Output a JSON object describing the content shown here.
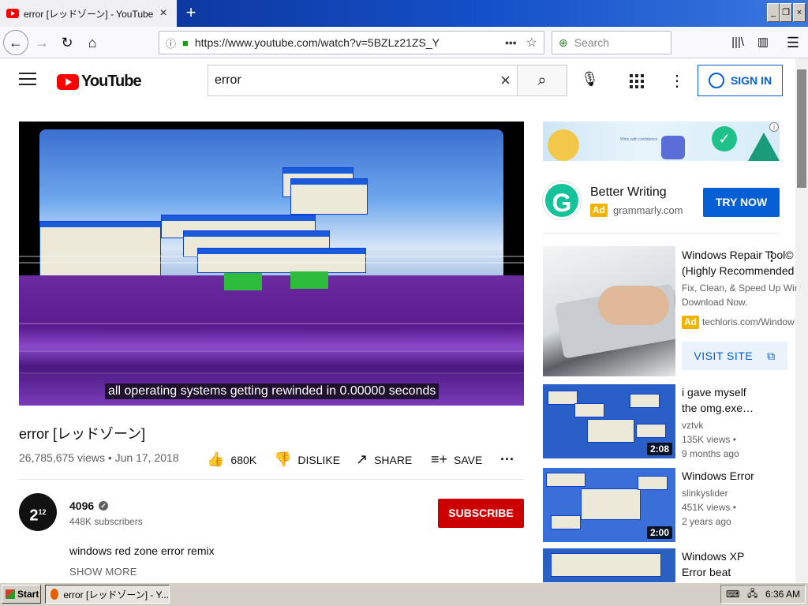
{
  "browser": {
    "tab_title": "error [レッドゾーン] - YouTube",
    "tab_close": "×",
    "new_tab": "+",
    "url": "https://www.youtube.com/watch?v=5BZLz21ZS_Y",
    "search_placeholder": "Search",
    "window_controls": [
      "_",
      "❐",
      "×"
    ]
  },
  "youtube_header": {
    "logo_text": "YouTube",
    "search_query": "error",
    "sign_in_label": "SIGN IN"
  },
  "player": {
    "caption": "all operating systems getting rewinded in 0.00000 seconds"
  },
  "video": {
    "title": "error [レッドゾーン]",
    "meta": "26,785,675 views • Jun 17, 2018",
    "actions": {
      "likes": "680K",
      "dislike": "DISLIKE",
      "share": "SHARE",
      "save": "SAVE"
    },
    "channel": {
      "avatar_text": "2",
      "name": "4096",
      "subscribers": "448K subscribers"
    },
    "subscribe_label": "SUBSCRIBE",
    "description": "windows red zone error remix",
    "show_more": "SHOW MORE"
  },
  "sidebar": {
    "ad": {
      "title": "Better Writing",
      "badge": "Ad",
      "domain": "grammarly.com",
      "cta": "TRY NOW",
      "logo_letter": "G",
      "banner_tagline": "Write with confidence"
    },
    "sponsored": {
      "title_line1": "Windows Repair Tool©",
      "title_line2": "(Highly Recommended",
      "desc_line1": "Fix, Clean, & Speed Up Win",
      "desc_line2": "Download Now.",
      "badge": "Ad",
      "domain": "techloris.com/Window",
      "cta": "VISIT SITE"
    },
    "related": [
      {
        "title_line1": "i gave myself",
        "title_line2": "the omg.exe…",
        "channel": "vztvk",
        "views": "135K views •",
        "ago": "9 months ago",
        "duration": "2:08"
      },
      {
        "title_line1": "Windows Error",
        "title_line2": "",
        "channel": "slinkyslider",
        "views": "451K views •",
        "ago": "2 years ago",
        "duration": "2:00"
      },
      {
        "title_line1": "Windows XP",
        "title_line2": "Error beat",
        "channel": "",
        "views": "",
        "ago": "",
        "duration": ""
      }
    ]
  },
  "taskbar": {
    "start_label": "Start",
    "task_label": "error [レッドゾーン] - Y...",
    "clock": "6:36 AM"
  },
  "colors": {
    "youtube_red": "#ff0000",
    "subscribe_red": "#cc0000",
    "link_blue": "#065fd4",
    "ad_yellow": "#f0b400"
  }
}
